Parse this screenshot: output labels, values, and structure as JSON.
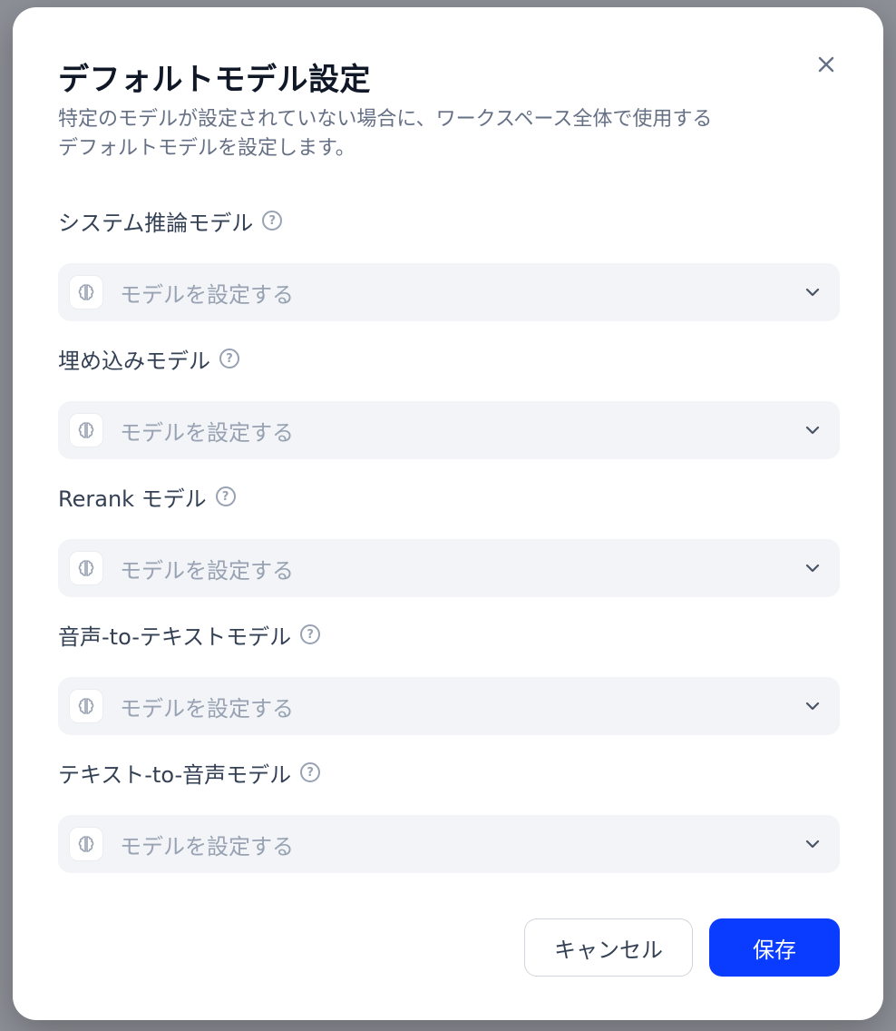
{
  "modal": {
    "title": "デフォルトモデル設定",
    "description_lines": [
      "特定のモデルが設定されていない場合に、ワークスペース全体で使用する",
      "デフォルトモデルを設定します。"
    ],
    "close_icon": "close-icon"
  },
  "fields": [
    {
      "label": "システム推論モデル",
      "placeholder": "モデルを設定する"
    },
    {
      "label": "埋め込みモデル",
      "placeholder": "モデルを設定する"
    },
    {
      "label": "Rerank モデル",
      "placeholder": "モデルを設定する"
    },
    {
      "label": "音声-to-テキストモデル",
      "placeholder": "モデルを設定する"
    },
    {
      "label": "テキスト-to-音声モデル",
      "placeholder": "モデルを設定する"
    }
  ],
  "help_icon_glyph": "?",
  "buttons": {
    "cancel": "キャンセル",
    "save": "保存"
  },
  "colors": {
    "accent": "#0a3cff",
    "title": "#101828",
    "muted": "#98a2b3",
    "select_bg": "#f2f4f7"
  }
}
